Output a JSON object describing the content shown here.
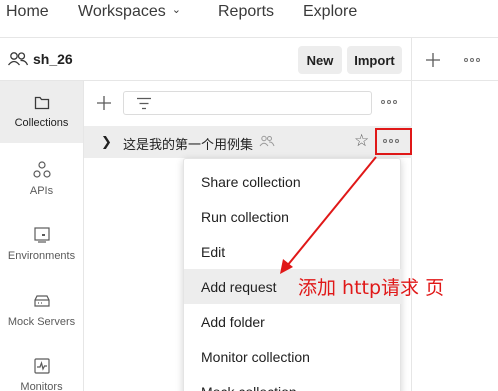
{
  "topnav": {
    "home": "Home",
    "workspaces": "Workspaces",
    "reports": "Reports",
    "explore": "Explore"
  },
  "workspace": {
    "name": "sh_26",
    "new_label": "New",
    "import_label": "Import"
  },
  "sidebar": {
    "items": [
      {
        "label": "Collections",
        "icon": "collections-icon"
      },
      {
        "label": "APIs",
        "icon": "apis-icon"
      },
      {
        "label": "Environments",
        "icon": "environments-icon"
      },
      {
        "label": "Mock Servers",
        "icon": "mock-servers-icon"
      },
      {
        "label": "Monitors",
        "icon": "monitors-icon"
      }
    ]
  },
  "collection": {
    "name": "这是我的第一个用例集"
  },
  "menu": {
    "items": [
      "Share collection",
      "Run collection",
      "Edit",
      "Add request",
      "Add folder",
      "Monitor collection",
      "Mock collection"
    ]
  },
  "annotation": {
    "text": "添加 http请求 页",
    "color": "#e01818"
  }
}
